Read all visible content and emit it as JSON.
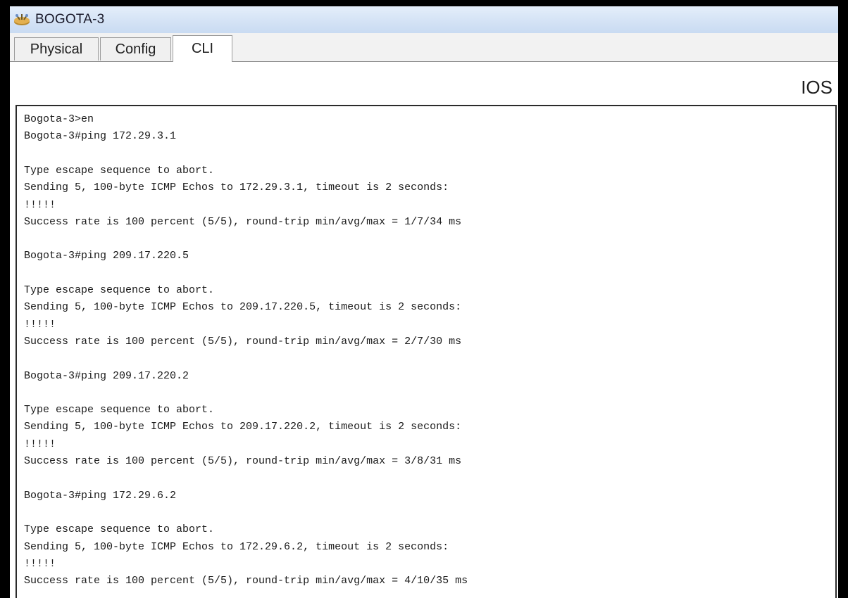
{
  "window": {
    "title": "BOGOTA-3"
  },
  "tabs": [
    {
      "label": "Physical"
    },
    {
      "label": "Config"
    },
    {
      "label": "CLI"
    }
  ],
  "active_tab": "CLI",
  "ios_label": "IOS",
  "console": {
    "lines": [
      "Bogota-3>en",
      "Bogota-3#ping 172.29.3.1",
      "",
      "Type escape sequence to abort.",
      "Sending 5, 100-byte ICMP Echos to 172.29.3.1, timeout is 2 seconds:",
      "!!!!!",
      "Success rate is 100 percent (5/5), round-trip min/avg/max = 1/7/34 ms",
      "",
      "Bogota-3#ping 209.17.220.5",
      "",
      "Type escape sequence to abort.",
      "Sending 5, 100-byte ICMP Echos to 209.17.220.5, timeout is 2 seconds:",
      "!!!!!",
      "Success rate is 100 percent (5/5), round-trip min/avg/max = 2/7/30 ms",
      "",
      "Bogota-3#ping 209.17.220.2",
      "",
      "Type escape sequence to abort.",
      "Sending 5, 100-byte ICMP Echos to 209.17.220.2, timeout is 2 seconds:",
      "!!!!!",
      "Success rate is 100 percent (5/5), round-trip min/avg/max = 3/8/31 ms",
      "",
      "Bogota-3#ping 172.29.6.2",
      "",
      "Type escape sequence to abort.",
      "Sending 5, 100-byte ICMP Echos to 172.29.6.2, timeout is 2 seconds:",
      "!!!!!",
      "Success rate is 100 percent (5/5), round-trip min/avg/max = 4/10/35 ms"
    ]
  }
}
